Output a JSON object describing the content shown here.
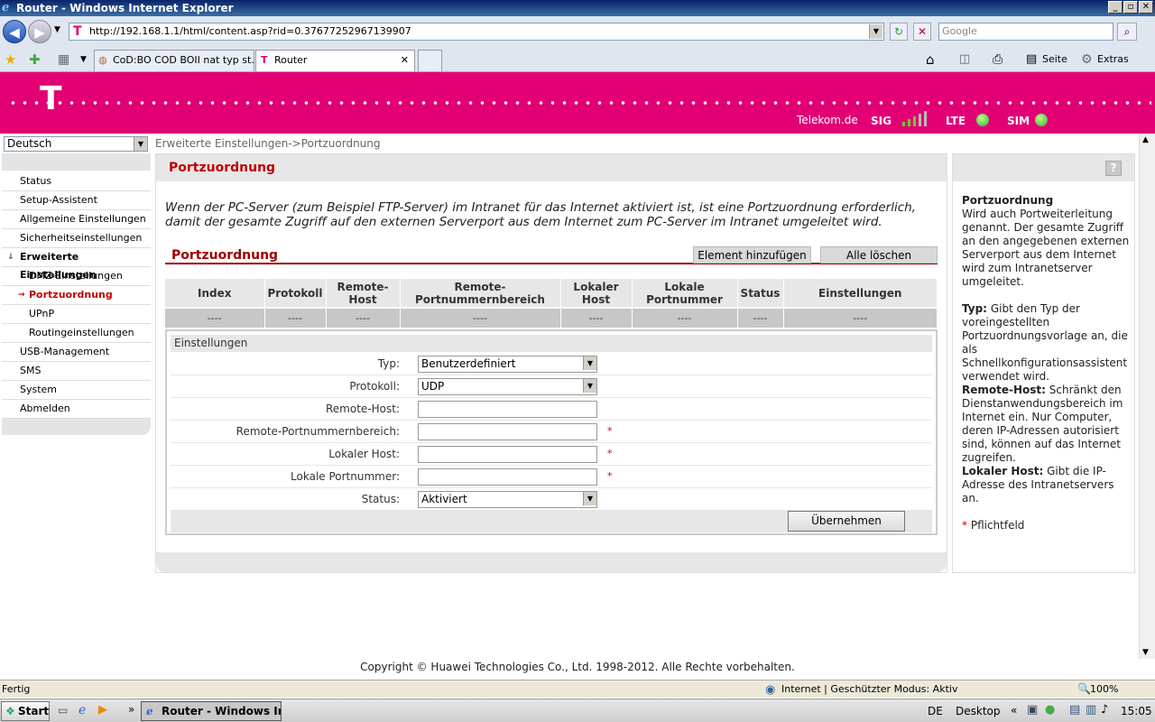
{
  "window": {
    "title": "Router - Windows Internet Explorer"
  },
  "address_bar": {
    "url": "http://192.168.1.1/html/content.asp?rid=0.37677252967139907",
    "search_placeholder": "Google"
  },
  "tabs": [
    {
      "label": "CoD:BO COD BOII nat typ st..."
    },
    {
      "label": "Router"
    }
  ],
  "toolbar": {
    "page_label": "Seite",
    "extras_label": "Extras"
  },
  "header": {
    "brand_link": "Telekom.de",
    "sig_label": "SIG",
    "signal_bars": 5,
    "lte_label": "LTE",
    "sim_label": "SIM",
    "status_color": "#55cc33",
    "brand_color": "#e20074"
  },
  "language": {
    "selected": "Deutsch"
  },
  "breadcrumb": "Erweiterte Einstellungen->Portzuordnung",
  "sidebar": {
    "items": [
      {
        "label": "Status"
      },
      {
        "label": "Setup-Assistent"
      },
      {
        "label": "Allgemeine Einstellungen"
      },
      {
        "label": "Sicherheitseinstellungen"
      },
      {
        "label": "Erweiterte Einstellungen"
      },
      {
        "label": "DMZ-Einstellungen"
      },
      {
        "label": "Portzuordnung"
      },
      {
        "label": "UPnP"
      },
      {
        "label": "Routingeinstellungen"
      },
      {
        "label": "USB-Management"
      },
      {
        "label": "SMS"
      },
      {
        "label": "System"
      },
      {
        "label": "Abmelden"
      }
    ]
  },
  "main": {
    "title": "Portzuordnung",
    "intro": "Wenn der PC-Server (zum Beispiel FTP-Server) im Intranet für das Internet aktiviert ist, ist eine Portzuordnung erforderlich, damit der gesamte Zugriff auf den externen Serverport aus dem Internet zum PC-Server im Intranet umgeleitet wird.",
    "section_title": "Portzuordnung",
    "add_button": "Element hinzufügen",
    "delete_all_button": "Alle löschen",
    "table": {
      "columns": [
        "Index",
        "Protokoll",
        "Remote-Host",
        "Remote-Portnummernbereich",
        "Lokaler Host",
        "Lokale Portnummer",
        "Status",
        "Einstellungen"
      ],
      "rows": [
        [
          "----",
          "----",
          "----",
          "----",
          "----",
          "----",
          "----",
          "----"
        ]
      ]
    },
    "settings": {
      "caption": "Einstellungen",
      "type_label": "Typ:",
      "type_value": "Benutzerdefiniert",
      "protocol_label": "Protokoll:",
      "protocol_value": "UDP",
      "remote_host_label": "Remote-Host:",
      "remote_host_value": "",
      "remote_port_label": "Remote-Portnummernbereich:",
      "remote_port_value": "",
      "local_host_label": "Lokaler Host:",
      "local_host_value": "",
      "local_port_label": "Lokale Portnummer:",
      "local_port_value": "",
      "status_label": "Status:",
      "status_value": "Aktiviert",
      "required_mark": "*",
      "apply_button": "Übernehmen"
    }
  },
  "help": {
    "title": "Portzuordnung",
    "intro": "Wird auch Portweiterleitung genannt. Der gesamte Zugriff an den angegebenen externen Serverport aus dem Internet wird zum Intranetserver umgeleitet.",
    "typ_term": "Typ:",
    "typ_text": "Gibt den Typ der voreingestellten Portzuordnungsvorlage an, die als Schnellkonfigurationsassistent verwendet wird.",
    "remote_term": "Remote-Host:",
    "remote_text": "Schränkt den Dienstanwendungsbereich im Internet ein. Nur Computer, deren IP-Adressen autorisiert sind, können auf das Internet zugreifen.",
    "local_term": "Lokaler Host:",
    "local_text": "Gibt die IP-Adresse des Intranetservers an.",
    "required_mark": "*",
    "required_note": "Pflichtfeld"
  },
  "footer": {
    "copyright": "Copyright © Huawei Technologies Co., Ltd. 1998-2012. Alle Rechte vorbehalten."
  },
  "statusbar": {
    "left": "Fertig",
    "zone": "Internet | Geschützter Modus: Aktiv",
    "zoom": "100%"
  },
  "taskbar": {
    "start": "Start",
    "task": "Router - Windows Int...",
    "lang": "DE",
    "desktop": "Desktop",
    "time": "15:05"
  }
}
